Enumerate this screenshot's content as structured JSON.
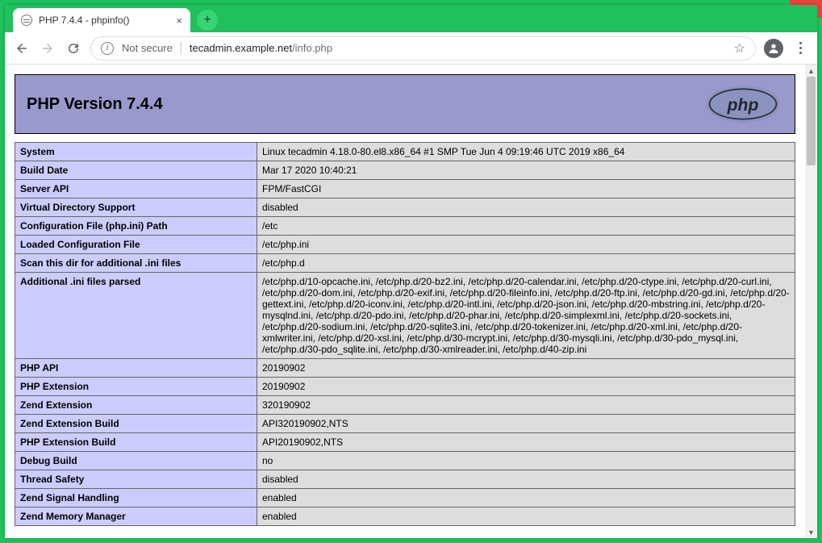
{
  "window": {
    "title": "PHP 7.4.4 - phpinfo()"
  },
  "browser": {
    "not_secure_label": "Not secure",
    "url_host": "tecadmin.example.net",
    "url_path": "/info.php"
  },
  "page": {
    "header_title": "PHP Version 7.4.4",
    "rows": [
      {
        "k": "System",
        "v": "Linux tecadmin 4.18.0-80.el8.x86_64 #1 SMP Tue Jun 4 09:19:46 UTC 2019 x86_64"
      },
      {
        "k": "Build Date",
        "v": "Mar 17 2020 10:40:21"
      },
      {
        "k": "Server API",
        "v": "FPM/FastCGI"
      },
      {
        "k": "Virtual Directory Support",
        "v": "disabled"
      },
      {
        "k": "Configuration File (php.ini) Path",
        "v": "/etc"
      },
      {
        "k": "Loaded Configuration File",
        "v": "/etc/php.ini"
      },
      {
        "k": "Scan this dir for additional .ini files",
        "v": "/etc/php.d"
      },
      {
        "k": "Additional .ini files parsed",
        "v": "/etc/php.d/10-opcache.ini, /etc/php.d/20-bz2.ini, /etc/php.d/20-calendar.ini, /etc/php.d/20-ctype.ini, /etc/php.d/20-curl.ini, /etc/php.d/20-dom.ini, /etc/php.d/20-exif.ini, /etc/php.d/20-fileinfo.ini, /etc/php.d/20-ftp.ini, /etc/php.d/20-gd.ini, /etc/php.d/20-gettext.ini, /etc/php.d/20-iconv.ini, /etc/php.d/20-intl.ini, /etc/php.d/20-json.ini, /etc/php.d/20-mbstring.ini, /etc/php.d/20-mysqlnd.ini, /etc/php.d/20-pdo.ini, /etc/php.d/20-phar.ini, /etc/php.d/20-simplexml.ini, /etc/php.d/20-sockets.ini, /etc/php.d/20-sodium.ini, /etc/php.d/20-sqlite3.ini, /etc/php.d/20-tokenizer.ini, /etc/php.d/20-xml.ini, /etc/php.d/20-xmlwriter.ini, /etc/php.d/20-xsl.ini, /etc/php.d/30-mcrypt.ini, /etc/php.d/30-mysqli.ini, /etc/php.d/30-pdo_mysql.ini, /etc/php.d/30-pdo_sqlite.ini, /etc/php.d/30-xmlreader.ini, /etc/php.d/40-zip.ini"
      },
      {
        "k": "PHP API",
        "v": "20190902"
      },
      {
        "k": "PHP Extension",
        "v": "20190902"
      },
      {
        "k": "Zend Extension",
        "v": "320190902"
      },
      {
        "k": "Zend Extension Build",
        "v": "API320190902,NTS"
      },
      {
        "k": "PHP Extension Build",
        "v": "API20190902,NTS"
      },
      {
        "k": "Debug Build",
        "v": "no"
      },
      {
        "k": "Thread Safety",
        "v": "disabled"
      },
      {
        "k": "Zend Signal Handling",
        "v": "enabled"
      },
      {
        "k": "Zend Memory Manager",
        "v": "enabled"
      }
    ]
  }
}
